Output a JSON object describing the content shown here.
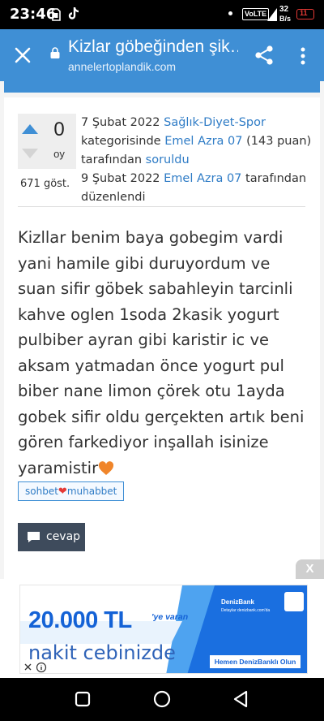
{
  "status": {
    "time": "23:46",
    "net_speed_top": "32",
    "net_speed_bottom": "B/s",
    "battery": "11",
    "volte": "VoLTE"
  },
  "browser": {
    "title": "Kizlar göbeğinden şik…",
    "url": "annelertoplandik.com",
    "icons": [
      "close-icon",
      "lock-icon",
      "share-icon",
      "more-vert-icon"
    ]
  },
  "question": {
    "votes": "0",
    "vote_unit": "oy",
    "views": "671 göst.",
    "meta": {
      "asked_date": "7 Şubat 2022",
      "category": "Sağlık-Diyet-Spor",
      "category_suffix": "kategorisinde",
      "asker": "Emel Azra 07",
      "points": "(143 puan)",
      "asked_by_word": "tarafından",
      "asked_link": "soruldu",
      "edited_date": "9 Şubat 2022",
      "editor": "Emel Azra 07",
      "edited_by_word": "tarafından",
      "edited_word": "düzenlendi"
    },
    "body": "Kizllar benim baya gobegim vardi yani hamile gibi duruyordum ve suan sifir göbek sabahleyin tarcinli kahve oglen 1soda 2kasik yogurt pulbiber ayran gibi karistir ic ve aksam yatmadan önce yogurt pul biber nane limon çörek otu 1ayda gobek sifir oldu gerçekten artık beni gören farkediyor inşallah isinize yaramistir",
    "tag_left": "sohbet",
    "tag_right": "muhabbet",
    "reply_label": "cevap"
  },
  "ad": {
    "close_x": "X",
    "amount": "20.000 TL",
    "amount_suffix": "'ye varan",
    "line2": "nakit cebinizde",
    "brand": "DenizBank",
    "brand_sub": "Detaylar denizbank.com'da",
    "cta": "Hemen DenizBanklı Olun",
    "accent": "#1462d6"
  },
  "colors": {
    "appbar": "#3f8fd5",
    "link": "#2f7cc6",
    "text": "#333333",
    "button": "#3e4b5c"
  }
}
